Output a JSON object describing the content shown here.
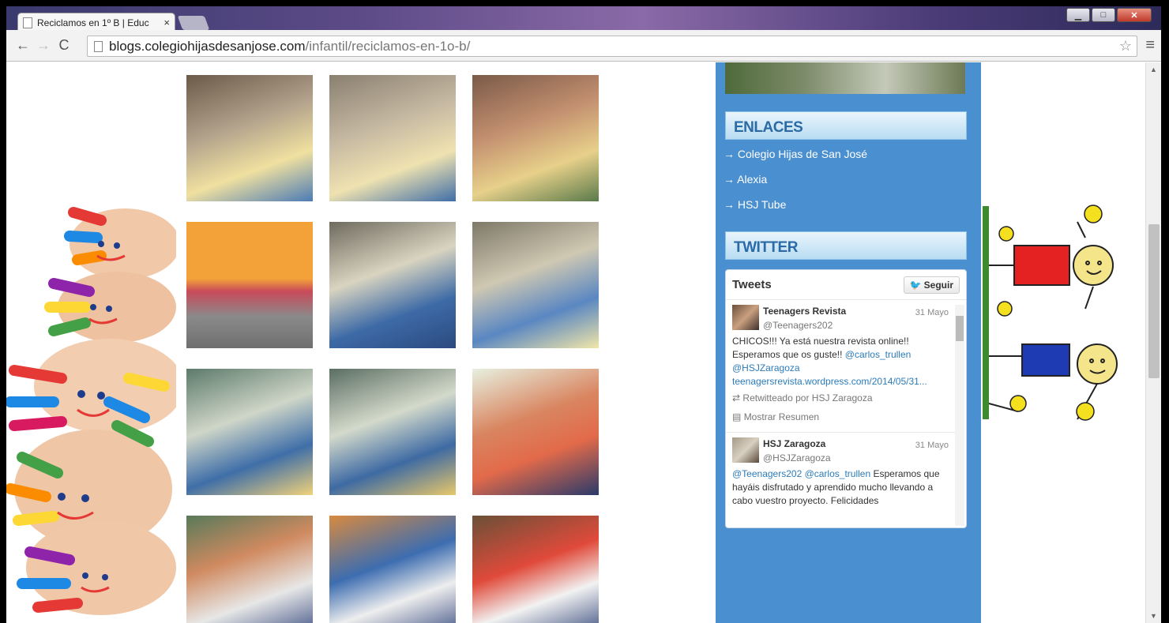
{
  "browser": {
    "tab_title": "Reciclamos en 1º B | Educ",
    "tab_close": "×",
    "url_host": "blogs.colegiohijasdesanjose.com",
    "url_path": "/infantil/reciclamos-en-1o-b/",
    "window_controls": {
      "minimize": "▁",
      "maximize": "□",
      "close": "✕"
    }
  },
  "sidebar": {
    "enlaces_title": "ENLACES",
    "links": [
      "Colegio Hijas de San José",
      "Alexia",
      "HSJ Tube"
    ],
    "link_arrow": "→",
    "twitter_title": "TWITTER"
  },
  "twitter": {
    "header": "Tweets",
    "follow": "Seguir",
    "tweets": [
      {
        "name": "Teenagers Revista",
        "handle": "@Teenagers202",
        "date": "31 Mayo",
        "text": "CHICOS!!! Ya está nuestra revista online!! Esperamos que os guste!!",
        "mention1": "@carlos_trullen",
        "mention2": "@HSJZaragoza",
        "link": "teenagersrevista.wordpress.com/2014/05/31...",
        "retweet": "Retwitteado por HSJ Zaragoza",
        "summary": "Mostrar Resumen"
      },
      {
        "name": "HSJ Zaragoza",
        "handle": "@HSJZaragoza",
        "date": "31 Mayo",
        "mentions": "@Teenagers202 @carlos_trullen",
        "text": "Esperamos que hayáis disfrutado y aprendido mucho llevando a cabo vuestro proyecto. Felicidades"
      }
    ]
  },
  "gallery": {
    "photos": [
      {
        "label": "photo-kids-table-1"
      },
      {
        "label": "photo-kids-table-2"
      },
      {
        "label": "photo-girl-table"
      },
      {
        "label": "photo-paper-caterpillar"
      },
      {
        "label": "photo-classroom-screen-1"
      },
      {
        "label": "photo-classroom-screen-2"
      },
      {
        "label": "photo-classroom-screen-3"
      },
      {
        "label": "photo-classroom-screen-4"
      },
      {
        "label": "photo-red-table"
      },
      {
        "label": "photo-drawing-1"
      },
      {
        "label": "photo-drawing-2"
      },
      {
        "label": "photo-drawing-3"
      }
    ]
  },
  "colors": {
    "sidebar": "#4a8fcf",
    "widget_title": "#2a6aa5",
    "link": "#2b7bb9"
  }
}
